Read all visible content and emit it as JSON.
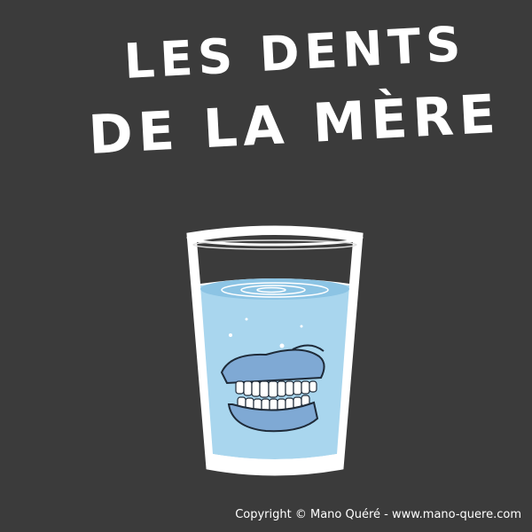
{
  "title": {
    "line1": "LES DENTS",
    "line2": "DE LA MÈRE"
  },
  "illustration": {
    "subject": "glass-of-water-with-dentures-icon",
    "colors": {
      "background": "#3b3b3b",
      "water": "#a9d6ee",
      "water_dark": "#86c0e2",
      "gums": "#7fa9d4",
      "teeth": "#ffffff",
      "outline": "#1e2a38"
    }
  },
  "footer": {
    "copyright": "Copyright ©  Mano Quéré - www.mano-quere.com"
  }
}
